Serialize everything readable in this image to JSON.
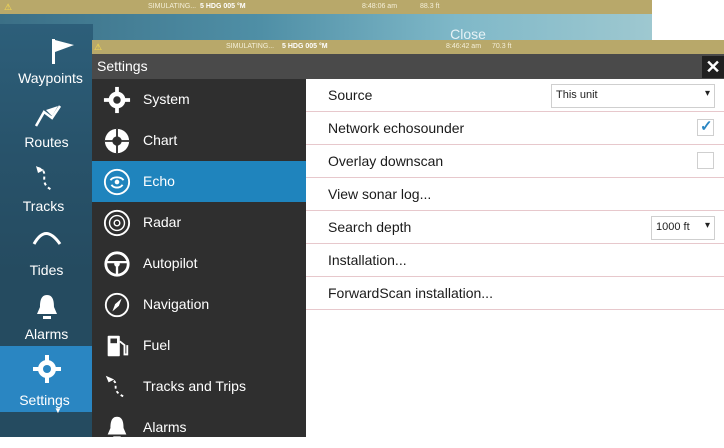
{
  "background_window": {
    "status": {
      "left": "SIMULATING...",
      "heading": "5 HDG 005 °M",
      "time": "8:48:06 am",
      "depth": "88.3 ft"
    },
    "close_label": "Close",
    "nav": [
      {
        "label": "Waypoints",
        "icon": "flag-icon"
      },
      {
        "label": "Routes",
        "icon": "route-icon"
      },
      {
        "label": "Tracks",
        "icon": "tracks-icon"
      },
      {
        "label": "Tides",
        "icon": "tides-icon"
      },
      {
        "label": "Alarms",
        "icon": "bell-icon"
      },
      {
        "label": "Settings",
        "icon": "gear-icon",
        "active": true
      }
    ]
  },
  "settings_window": {
    "status": {
      "left": "SIMULATING...",
      "heading": "5 HDG 005 °M",
      "time": "8:46:42 am",
      "depth": "70.3 ft"
    },
    "title": "Settings",
    "close_glyph": "✕",
    "menu": [
      {
        "label": "System",
        "icon": "gear-icon"
      },
      {
        "label": "Chart",
        "icon": "chart-icon"
      },
      {
        "label": "Echo",
        "icon": "echo-icon",
        "active": true
      },
      {
        "label": "Radar",
        "icon": "radar-icon"
      },
      {
        "label": "Autopilot",
        "icon": "steering-wheel-icon"
      },
      {
        "label": "Navigation",
        "icon": "compass-icon"
      },
      {
        "label": "Fuel",
        "icon": "fuel-pump-icon"
      },
      {
        "label": "Tracks and Trips",
        "icon": "tracks-icon"
      },
      {
        "label": "Alarms",
        "icon": "bell-icon"
      }
    ],
    "rows": [
      {
        "label": "Source",
        "control": "dropdown",
        "value": "This unit"
      },
      {
        "label": "Network echosounder",
        "control": "checkbox",
        "checked": true
      },
      {
        "label": "Overlay downscan",
        "control": "checkbox",
        "checked": false
      },
      {
        "label": "View sonar log...",
        "control": "none"
      },
      {
        "label": "Search depth",
        "control": "dropdown",
        "value": "1000 ft"
      },
      {
        "label": "Installation...",
        "control": "none"
      },
      {
        "label": "ForwardScan installation...",
        "control": "none"
      }
    ],
    "colors": {
      "accent": "#1f84bd",
      "status_bar": "#b8a86a",
      "menu_bg": "#2f2f2f",
      "row_divider": "#e7c8cc"
    }
  }
}
